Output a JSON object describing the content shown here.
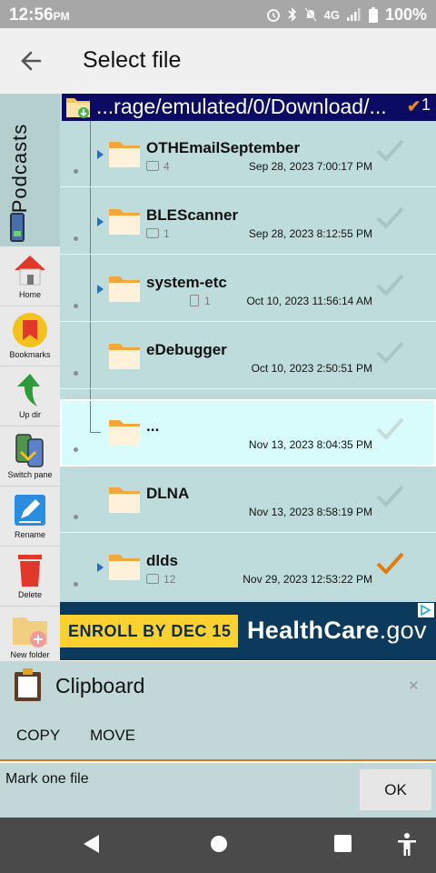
{
  "status_bar": {
    "time": "12:56",
    "ampm": "PM",
    "network": "4G",
    "battery": "100%"
  },
  "app_bar": {
    "back_icon": "arrow-left-icon",
    "title": "Select file"
  },
  "side_tab": {
    "label": "Podcasts"
  },
  "path_bar": {
    "path": "...rage/emulated/0/Download/...",
    "marked_count": "1"
  },
  "files": [
    {
      "name": "OTHEmailSeptember",
      "date": "Sep 28, 2023 7:00:17 PM",
      "folders": "4",
      "files": "",
      "expandable": true,
      "marked": false
    },
    {
      "name": "BLEScanner",
      "date": "Sep 28, 2023 8:12:55 PM",
      "folders": "1",
      "files": "",
      "expandable": true,
      "marked": false
    },
    {
      "name": "system-etc",
      "date": "Oct 10, 2023 11:56:14 AM",
      "folders": "",
      "files": "1",
      "expandable": true,
      "marked": false
    },
    {
      "name": "eDebugger",
      "date": "Oct 10, 2023 2:50:51 PM",
      "folders": "",
      "files": "",
      "expandable": false,
      "marked": false
    },
    {
      "name": "...",
      "date": "Nov 13, 2023 8:04:35 PM",
      "folders": "",
      "files": "",
      "expandable": false,
      "marked": false,
      "selected": true
    },
    {
      "name": "DLNA",
      "date": "Nov 13, 2023 8:58:19 PM",
      "folders": "",
      "files": "",
      "expandable": false,
      "marked": false
    },
    {
      "name": "dlds",
      "date": "Nov 29, 2023 12:53:22 PM",
      "folders": "12",
      "files": "",
      "expandable": true,
      "marked": true
    }
  ],
  "toolbar": [
    {
      "label": "Home",
      "icon": "home-icon"
    },
    {
      "label": "Bookmarks",
      "icon": "bookmark-icon"
    },
    {
      "label": "Up dir",
      "icon": "up-arrow-icon"
    },
    {
      "label": "Switch pane",
      "icon": "switch-pane-icon"
    },
    {
      "label": "Rename",
      "icon": "rename-icon"
    },
    {
      "label": "Delete",
      "icon": "trash-icon"
    },
    {
      "label": "New folder",
      "icon": "new-folder-icon"
    }
  ],
  "ad": {
    "left_text": "ENROLL BY DEC 15",
    "brand_bold": "HealthCare",
    "brand_light": ".gov"
  },
  "clipboard": {
    "title": "Clipboard",
    "close_icon": "close-icon",
    "copy_label": "COPY",
    "move_label": "MOVE"
  },
  "bottom": {
    "message": "Mark one file",
    "ok_label": "OK"
  },
  "colors": {
    "list_bg": "#bedcdb",
    "path_bar_bg": "#0b0b63",
    "accent_orange": "#e58a19",
    "selected_row": "#d8fbfb"
  }
}
